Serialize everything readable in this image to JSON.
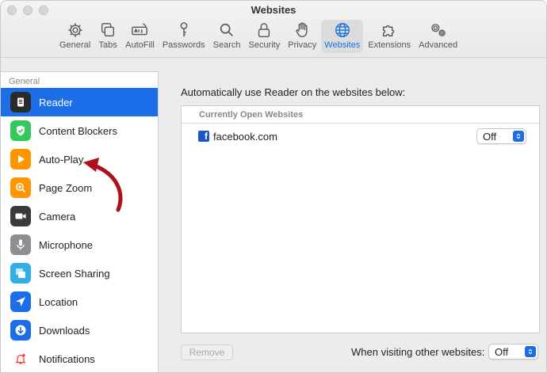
{
  "window": {
    "title": "Websites"
  },
  "toolbar": {
    "items": [
      {
        "label": "General",
        "icon": "gear-icon"
      },
      {
        "label": "Tabs",
        "icon": "tabs-icon"
      },
      {
        "label": "AutoFill",
        "icon": "autofill-icon"
      },
      {
        "label": "Passwords",
        "icon": "key-icon"
      },
      {
        "label": "Search",
        "icon": "search-icon"
      },
      {
        "label": "Security",
        "icon": "lock-icon"
      },
      {
        "label": "Privacy",
        "icon": "hand-icon"
      },
      {
        "label": "Websites",
        "icon": "globe-icon",
        "active": true
      },
      {
        "label": "Extensions",
        "icon": "puzzle-icon"
      },
      {
        "label": "Advanced",
        "icon": "gears-icon"
      }
    ]
  },
  "sidebar": {
    "header": "General",
    "items": [
      {
        "label": "Reader",
        "icon": "reader-icon",
        "color": "#2b2b2b",
        "selected": true
      },
      {
        "label": "Content Blockers",
        "icon": "shield-check-icon",
        "color": "#34c759"
      },
      {
        "label": "Auto-Play",
        "icon": "play-icon",
        "color": "#ff9500"
      },
      {
        "label": "Page Zoom",
        "icon": "zoom-icon",
        "color": "#ff9500"
      },
      {
        "label": "Camera",
        "icon": "camera-icon",
        "color": "#3a3a3c"
      },
      {
        "label": "Microphone",
        "icon": "microphone-icon",
        "color": "#8e8e93"
      },
      {
        "label": "Screen Sharing",
        "icon": "screen-sharing-icon",
        "color": "#32ade6"
      },
      {
        "label": "Location",
        "icon": "location-icon",
        "color": "#1c6ee8"
      },
      {
        "label": "Downloads",
        "icon": "download-icon",
        "color": "#1c6ee8"
      },
      {
        "label": "Notifications",
        "icon": "bell-icon",
        "color": "#ff3b30"
      }
    ]
  },
  "main": {
    "heading": "Automatically use Reader on the websites below:",
    "list_header": "Currently Open Websites",
    "sites": [
      {
        "name": "facebook.com",
        "setting": "Off"
      }
    ],
    "remove_label": "Remove",
    "other_label": "When visiting other websites:",
    "other_value": "Off"
  },
  "accent_color": "#1c6ee8",
  "annotation_color": "#b0101c"
}
